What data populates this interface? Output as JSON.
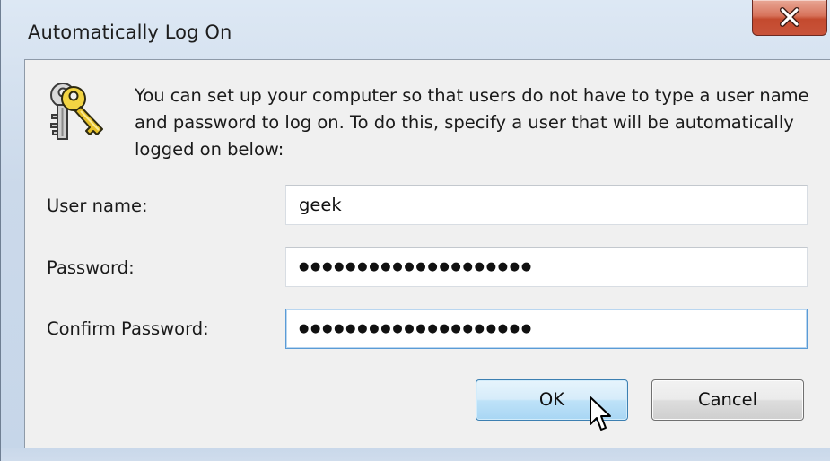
{
  "window": {
    "title": "Automatically Log On"
  },
  "message": "You can set up your computer so that users do not have to type a user name and password to log on. To do this, specify a user that will be automatically logged on below:",
  "fields": {
    "username": {
      "label": "User name:",
      "value": "geek"
    },
    "password": {
      "label": "Password:",
      "value": "●●●●●●●●●●●●●●●●●●●●"
    },
    "confirm": {
      "label": "Confirm Password:",
      "value": "●●●●●●●●●●●●●●●●●●●●"
    }
  },
  "buttons": {
    "ok": "OK",
    "cancel": "Cancel"
  },
  "icons": {
    "window_close": "close-icon",
    "dialog_icon": "keys-icon",
    "pointer": "mouse-cursor-icon"
  },
  "colors": {
    "titlebar": "#cbd9ea",
    "client": "#f0f0f0",
    "close_button": "#c8533a",
    "ok_button": "#bee2f8",
    "focus_border": "#5a9bd6"
  }
}
